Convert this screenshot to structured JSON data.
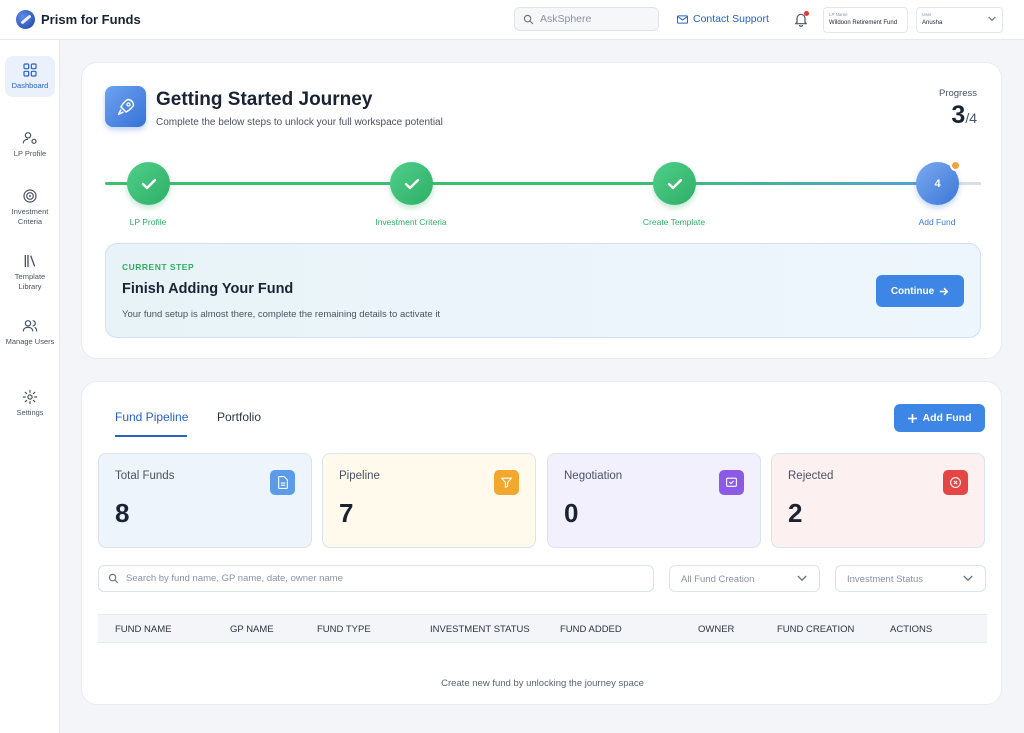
{
  "app": {
    "name": "Prism for Funds"
  },
  "topbar": {
    "search_placeholder": "AskSphere",
    "contact_label": "Contact Support",
    "lp_name_label": "LP Name",
    "lp_name_value": "Wildoon Retirement Fund",
    "user_label": "User",
    "user_value": "Anusha"
  },
  "sidebar": {
    "items": [
      {
        "label": "Dashboard",
        "icon": "grid-icon",
        "active": true
      },
      {
        "label": "LP Profile",
        "icon": "user-settings-icon"
      },
      {
        "label": "Investment Criteria",
        "icon": "target-icon"
      },
      {
        "label": "Template Library",
        "icon": "library-icon"
      },
      {
        "label": "Manage Users",
        "icon": "users-icon"
      },
      {
        "label": "Settings",
        "icon": "gear-icon"
      }
    ]
  },
  "journey": {
    "title": "Getting Started Journey",
    "subtitle": "Complete the below steps to unlock your full workspace potential",
    "progress_label": "Progress",
    "progress_current": "3",
    "progress_total": "/4",
    "steps": [
      {
        "label": "LP Profile",
        "status": "done"
      },
      {
        "label": "Investment Criteria",
        "status": "done"
      },
      {
        "label": "Create Template",
        "status": "done"
      },
      {
        "label": "Add Fund",
        "status": "current",
        "number": "4"
      }
    ],
    "current_step": {
      "kicker": "CURRENT STEP",
      "title": "Finish Adding Your Fund",
      "description": "Your fund setup is almost there, complete the remaining details to activate it",
      "button_label": "Continue"
    }
  },
  "pipeline": {
    "tabs": [
      {
        "label": "Fund Pipeline",
        "active": true
      },
      {
        "label": "Portfolio",
        "active": false
      }
    ],
    "add_button_label": "Add Fund",
    "stats": [
      {
        "label": "Total Funds",
        "value": "8",
        "bg": "#eef4fc",
        "icon_bg": "#5b9be8",
        "icon": "document-icon"
      },
      {
        "label": "Pipeline",
        "value": "7",
        "bg": "#fffaec",
        "icon_bg": "#f2a72e",
        "icon": "funnel-icon"
      },
      {
        "label": "Negotiation",
        "value": "0",
        "bg": "#f3f0fd",
        "icon_bg": "#8b5be6",
        "icon": "handshake-icon"
      },
      {
        "label": "Rejected",
        "value": "2",
        "bg": "#fdf0f0",
        "icon_bg": "#e54545",
        "icon": "close-circle-icon"
      }
    ],
    "search_placeholder": "Search by fund name, GP name, date, owner name",
    "filter_fund_creation": "All Fund Creation",
    "filter_investment_status": "Investment Status",
    "columns": [
      "FUND NAME",
      "GP NAME",
      "FUND TYPE",
      "INVESTMENT STATUS",
      "FUND ADDED",
      "OWNER",
      "FUND CREATION",
      "ACTIONS"
    ],
    "empty_message": "Create new fund by unlocking the journey space"
  }
}
